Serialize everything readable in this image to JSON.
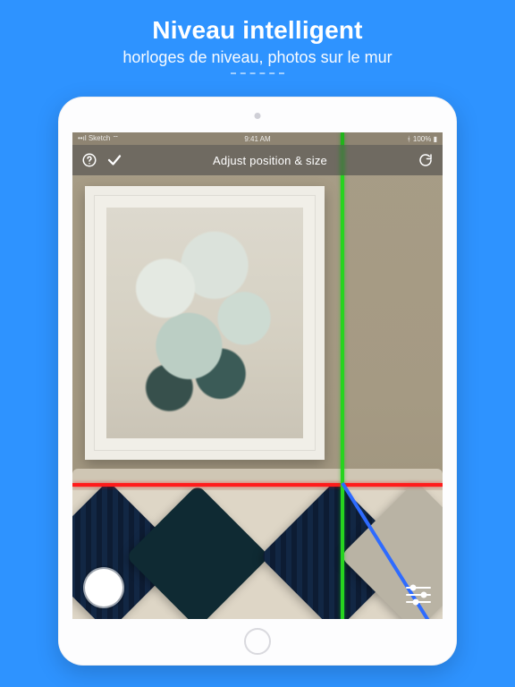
{
  "promo": {
    "title": "Niveau intelligent",
    "subtitle": "horloges de niveau, photos sur le mur"
  },
  "statusbar": {
    "left": "Sketch",
    "time": "9:41 AM",
    "right": "100%"
  },
  "appbar": {
    "title": "Adjust position & size"
  },
  "icons": {
    "help": "help-icon",
    "check": "check-icon",
    "refresh": "refresh-icon",
    "shutter": "shutter-button",
    "sliders": "sliders-icon",
    "wifi": "wifi-icon",
    "bluetooth": "bluetooth-icon",
    "battery": "battery-icon"
  },
  "guides": {
    "horizontal_color": "#ff1b1b",
    "vertical_color": "#27d41f",
    "tilt_color": "#2e6bff"
  }
}
